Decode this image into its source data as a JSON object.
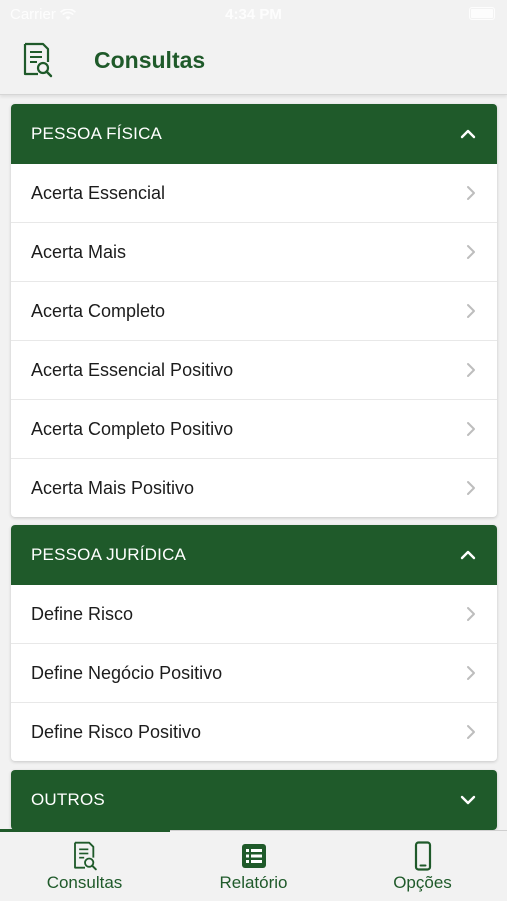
{
  "status_bar": {
    "carrier": "Carrier",
    "time": "4:34 PM"
  },
  "header": {
    "title": "Consultas",
    "icon": "document-search-icon"
  },
  "sections": [
    {
      "title": "PESSOA FÍSICA",
      "expanded": true,
      "items": [
        "Acerta Essencial",
        "Acerta Mais",
        "Acerta Completo",
        "Acerta Essencial Positivo",
        "Acerta Completo Positivo",
        "Acerta Mais Positivo"
      ]
    },
    {
      "title": "PESSOA JURÍDICA",
      "expanded": true,
      "items": [
        "Define Risco",
        "Define Negócio Positivo",
        "Define Risco Positivo"
      ]
    },
    {
      "title": "OUTROS",
      "expanded": false,
      "items": []
    }
  ],
  "tabs": [
    {
      "label": "Consultas",
      "icon": "document-search-icon",
      "active": true
    },
    {
      "label": "Relatório",
      "icon": "list-icon",
      "active": false
    },
    {
      "label": "Opções",
      "icon": "phone-icon",
      "active": false
    }
  ],
  "colors": {
    "primary": "#1f5a2a",
    "background": "#f2f2f2",
    "card": "#ffffff"
  }
}
